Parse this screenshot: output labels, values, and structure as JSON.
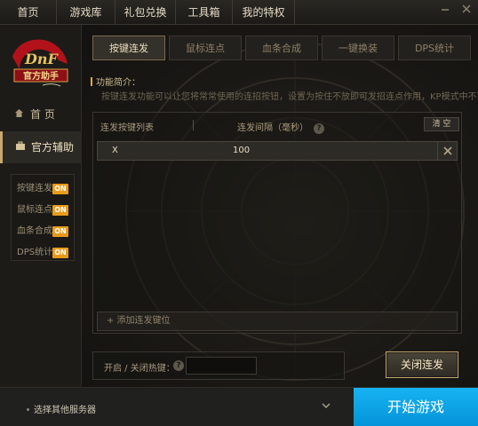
{
  "topnav": {
    "items": [
      "首页",
      "游戏库",
      "礼包兑换",
      "工具箱",
      "我的特权"
    ]
  },
  "window": {
    "minimize_icon": "minimize-icon",
    "close_icon": "close-icon"
  },
  "sidebar": {
    "logo_text": "官方助手",
    "home_label": "首 页",
    "assist_label": "官方辅助",
    "subitems": [
      {
        "label": "按键连发",
        "status": "ON"
      },
      {
        "label": "鼠标连点",
        "status": "ON"
      },
      {
        "label": "血条合成",
        "status": "ON"
      },
      {
        "label": "DPS统计",
        "status": "ON"
      }
    ]
  },
  "tabs": [
    "按键连发",
    "鼠标连点",
    "血条合成",
    "一键换装",
    "DPS统计"
  ],
  "function": {
    "title": "功能简介：",
    "desc": "按键连发功能可以让您将常常使用的连招按钮，设置为按住不放即可发招连点作用，KP模式中不可使用。"
  },
  "list": {
    "col1": "连发按键列表",
    "col2": "连发间隔（毫秒）",
    "help": "?",
    "clear_label": "清 空",
    "rows": [
      {
        "key": "X",
        "interval": "100"
      }
    ],
    "add_label": "+ 添加连发键位"
  },
  "hotkey": {
    "label": "开启 / 关闭热键：",
    "help": "?",
    "value": ""
  },
  "close_button": "关闭连发",
  "bottom": {
    "server_label": "选择其他服务器",
    "start_label": "开始游戏"
  },
  "colors": {
    "accent_on": "#e89a1a",
    "start_blue": "#0aa3e6",
    "gold_border": "#c2a66d"
  }
}
